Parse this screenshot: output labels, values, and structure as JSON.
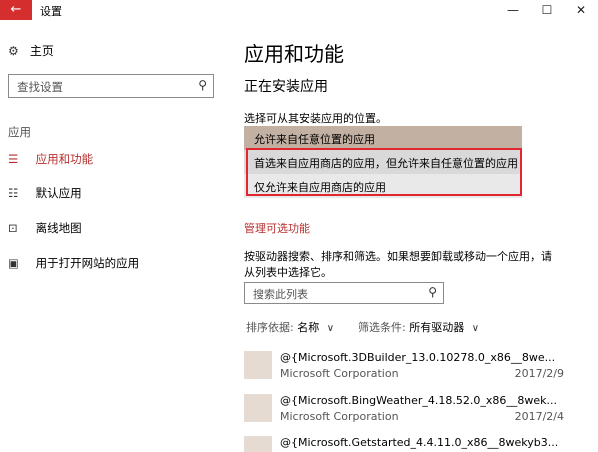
{
  "window": {
    "title": "设置",
    "back_icon": "←",
    "minimize_icon": "—",
    "maximize_icon": "☐",
    "close_icon": "✕"
  },
  "sidebar": {
    "home_icon": "⚙",
    "home": "主页",
    "search_placeholder": "查找设置",
    "search_icon": "⚲",
    "section": "应用",
    "items": [
      {
        "icon": "☰",
        "label": "应用和功能"
      },
      {
        "icon": "☷",
        "label": "默认应用"
      },
      {
        "icon": "⊡",
        "label": "离线地图"
      },
      {
        "icon": "▣",
        "label": "用于打开网站的应用"
      }
    ]
  },
  "main": {
    "title": "应用和功能",
    "install_heading": "正在安装应用",
    "choose_label": "选择可从其安装应用的位置。",
    "dropdown_options": [
      "允许来自任意位置的应用",
      "首选来自应用商店的应用，但允许来自任意位置的应用",
      "仅允许来自应用商店的应用"
    ],
    "manage_link": "管理可选功能",
    "description": "按驱动器搜索、排序和筛选。如果想要卸载或移动一个应用，请从列表中选择它。",
    "list_search_placeholder": "搜索此列表",
    "search_icon": "⚲",
    "sort_label": "排序依据:",
    "sort_value": "名称",
    "filter_label": "筛选条件:",
    "filter_value": "所有驱动器",
    "chevron": "∨",
    "apps": [
      {
        "name": "@{Microsoft.3DBuilder_13.0.10278.0_x86__8we...",
        "publisher": "Microsoft Corporation",
        "date": "2017/2/9"
      },
      {
        "name": "@{Microsoft.BingWeather_4.18.52.0_x86__8wek...",
        "publisher": "Microsoft Corporation",
        "date": "2017/2/4"
      },
      {
        "name": "@{Microsoft.Getstarted_4.4.11.0_x86__8wekyb3...",
        "publisher": "",
        "date": ""
      }
    ]
  },
  "colors": {
    "accent": "#b72f2f",
    "titlebar_back": "#d42e2e",
    "selected_option": "#c2b0a2",
    "highlight_frame": "#e0262e"
  }
}
